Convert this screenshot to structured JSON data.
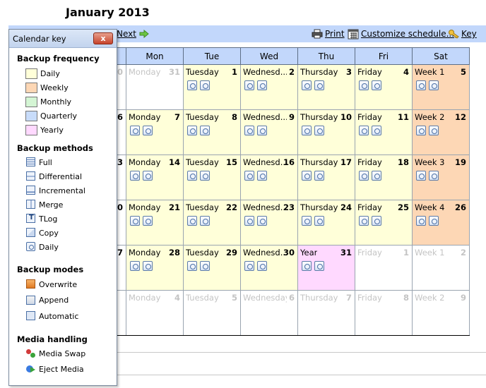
{
  "month_title": "January 2013",
  "toolbar": {
    "next_label": "Next",
    "print_label": "Print",
    "customize_label": "Customize schedule...",
    "key_label": "Key"
  },
  "weekdays": [
    "Mon",
    "Tue",
    "Wed",
    "Thu",
    "Fri",
    "Sat"
  ],
  "rows": [
    [
      {
        "name": "Monday",
        "day": "31",
        "type": "empty",
        "faded": true,
        "icons": 0
      },
      {
        "name": "Tuesday",
        "day": "1",
        "type": "daily",
        "faded": false,
        "icons": 2
      },
      {
        "name": "Wednesd...",
        "day": "2",
        "type": "daily",
        "faded": false,
        "icons": 2
      },
      {
        "name": "Thursday",
        "day": "3",
        "type": "daily",
        "faded": false,
        "icons": 2
      },
      {
        "name": "Friday",
        "day": "4",
        "type": "daily",
        "faded": false,
        "icons": 2
      },
      {
        "name": "Week 1",
        "day": "5",
        "type": "weekly",
        "faded": false,
        "icons": 2
      }
    ],
    [
      {
        "name": "Monday",
        "day": "7",
        "type": "daily",
        "faded": false,
        "icons": 2
      },
      {
        "name": "Tuesday",
        "day": "8",
        "type": "daily",
        "faded": false,
        "icons": 2
      },
      {
        "name": "Wednesd...",
        "day": "9",
        "type": "daily",
        "faded": false,
        "icons": 2
      },
      {
        "name": "Thursday",
        "day": "10",
        "type": "daily",
        "faded": false,
        "icons": 2
      },
      {
        "name": "Friday",
        "day": "11",
        "type": "daily",
        "faded": false,
        "icons": 2
      },
      {
        "name": "Week 2",
        "day": "12",
        "type": "weekly",
        "faded": false,
        "icons": 2
      }
    ],
    [
      {
        "name": "Monday",
        "day": "14",
        "type": "daily",
        "faded": false,
        "icons": 2
      },
      {
        "name": "Tuesday",
        "day": "15",
        "type": "daily",
        "faded": false,
        "icons": 2
      },
      {
        "name": "Wednesd...",
        "day": "16",
        "type": "daily",
        "faded": false,
        "icons": 2
      },
      {
        "name": "Thursday",
        "day": "17",
        "type": "daily",
        "faded": false,
        "icons": 2
      },
      {
        "name": "Friday",
        "day": "18",
        "type": "daily",
        "faded": false,
        "icons": 2
      },
      {
        "name": "Week 3",
        "day": "19",
        "type": "weekly",
        "faded": false,
        "icons": 2
      }
    ],
    [
      {
        "name": "Monday",
        "day": "21",
        "type": "daily",
        "faded": false,
        "icons": 2
      },
      {
        "name": "Tuesday",
        "day": "22",
        "type": "daily",
        "faded": false,
        "icons": 2
      },
      {
        "name": "Wednesd...",
        "day": "23",
        "type": "daily",
        "faded": false,
        "icons": 2
      },
      {
        "name": "Thursday",
        "day": "24",
        "type": "daily",
        "faded": false,
        "icons": 2
      },
      {
        "name": "Friday",
        "day": "25",
        "type": "daily",
        "faded": false,
        "icons": 2
      },
      {
        "name": "Week 4",
        "day": "26",
        "type": "weekly",
        "faded": false,
        "icons": 2
      }
    ],
    [
      {
        "name": "Monday",
        "day": "28",
        "type": "daily",
        "faded": false,
        "icons": 2
      },
      {
        "name": "Tuesday",
        "day": "29",
        "type": "daily",
        "faded": false,
        "icons": 2
      },
      {
        "name": "Wednesd...",
        "day": "30",
        "type": "daily",
        "faded": false,
        "icons": 2
      },
      {
        "name": "Year",
        "day": "31",
        "type": "yearly",
        "faded": false,
        "icons": 2
      },
      {
        "name": "Friday",
        "day": "1",
        "type": "empty",
        "faded": true,
        "icons": 0
      },
      {
        "name": "Week 1",
        "day": "2",
        "type": "empty",
        "faded": true,
        "icons": 0
      }
    ],
    [
      {
        "name": "Monday",
        "day": "4",
        "type": "empty",
        "faded": true,
        "icons": 0
      },
      {
        "name": "Tuesday",
        "day": "5",
        "type": "empty",
        "faded": true,
        "icons": 0
      },
      {
        "name": "Wednesday",
        "day": "6",
        "type": "empty",
        "faded": true,
        "icons": 0
      },
      {
        "name": "Thursday",
        "day": "7",
        "type": "empty",
        "faded": true,
        "icons": 0
      },
      {
        "name": "Friday",
        "day": "8",
        "type": "empty",
        "faded": true,
        "icons": 0
      },
      {
        "name": "Week 2",
        "day": "9",
        "type": "empty",
        "faded": true,
        "icons": 0
      }
    ]
  ],
  "partial_left_days": [
    "0",
    "6",
    "3",
    "0",
    "7",
    ""
  ],
  "key": {
    "title": "Calendar key",
    "close_label": "x",
    "frequency_heading": "Backup frequency",
    "frequency": [
      {
        "label": "Daily",
        "color": "#ffffd9"
      },
      {
        "label": "Weekly",
        "color": "#fdd7b5"
      },
      {
        "label": "Monthly",
        "color": "#d4f5d4"
      },
      {
        "label": "Quarterly",
        "color": "#c8dcfa"
      },
      {
        "label": "Yearly",
        "color": "#ffd9ff"
      }
    ],
    "methods_heading": "Backup methods",
    "methods": [
      {
        "label": "Full",
        "icon": "full-backup-icon"
      },
      {
        "label": "Differential",
        "icon": "differential-backup-icon"
      },
      {
        "label": "Incremental",
        "icon": "incremental-backup-icon"
      },
      {
        "label": "Merge",
        "icon": "merge-backup-icon"
      },
      {
        "label": "TLog",
        "icon": "tlog-backup-icon"
      },
      {
        "label": "Copy",
        "icon": "copy-backup-icon"
      },
      {
        "label": "Daily",
        "icon": "daily-backup-icon"
      }
    ],
    "modes_heading": "Backup modes",
    "modes": [
      {
        "label": "Overwrite",
        "icon": "overwrite-icon"
      },
      {
        "label": "Append",
        "icon": "append-icon"
      },
      {
        "label": "Automatic",
        "icon": "automatic-icon"
      }
    ],
    "media_heading": "Media handling",
    "media": [
      {
        "label": "Media Swap",
        "icon": "media-swap-icon"
      },
      {
        "label": "Eject Media",
        "icon": "eject-media-icon"
      }
    ]
  }
}
